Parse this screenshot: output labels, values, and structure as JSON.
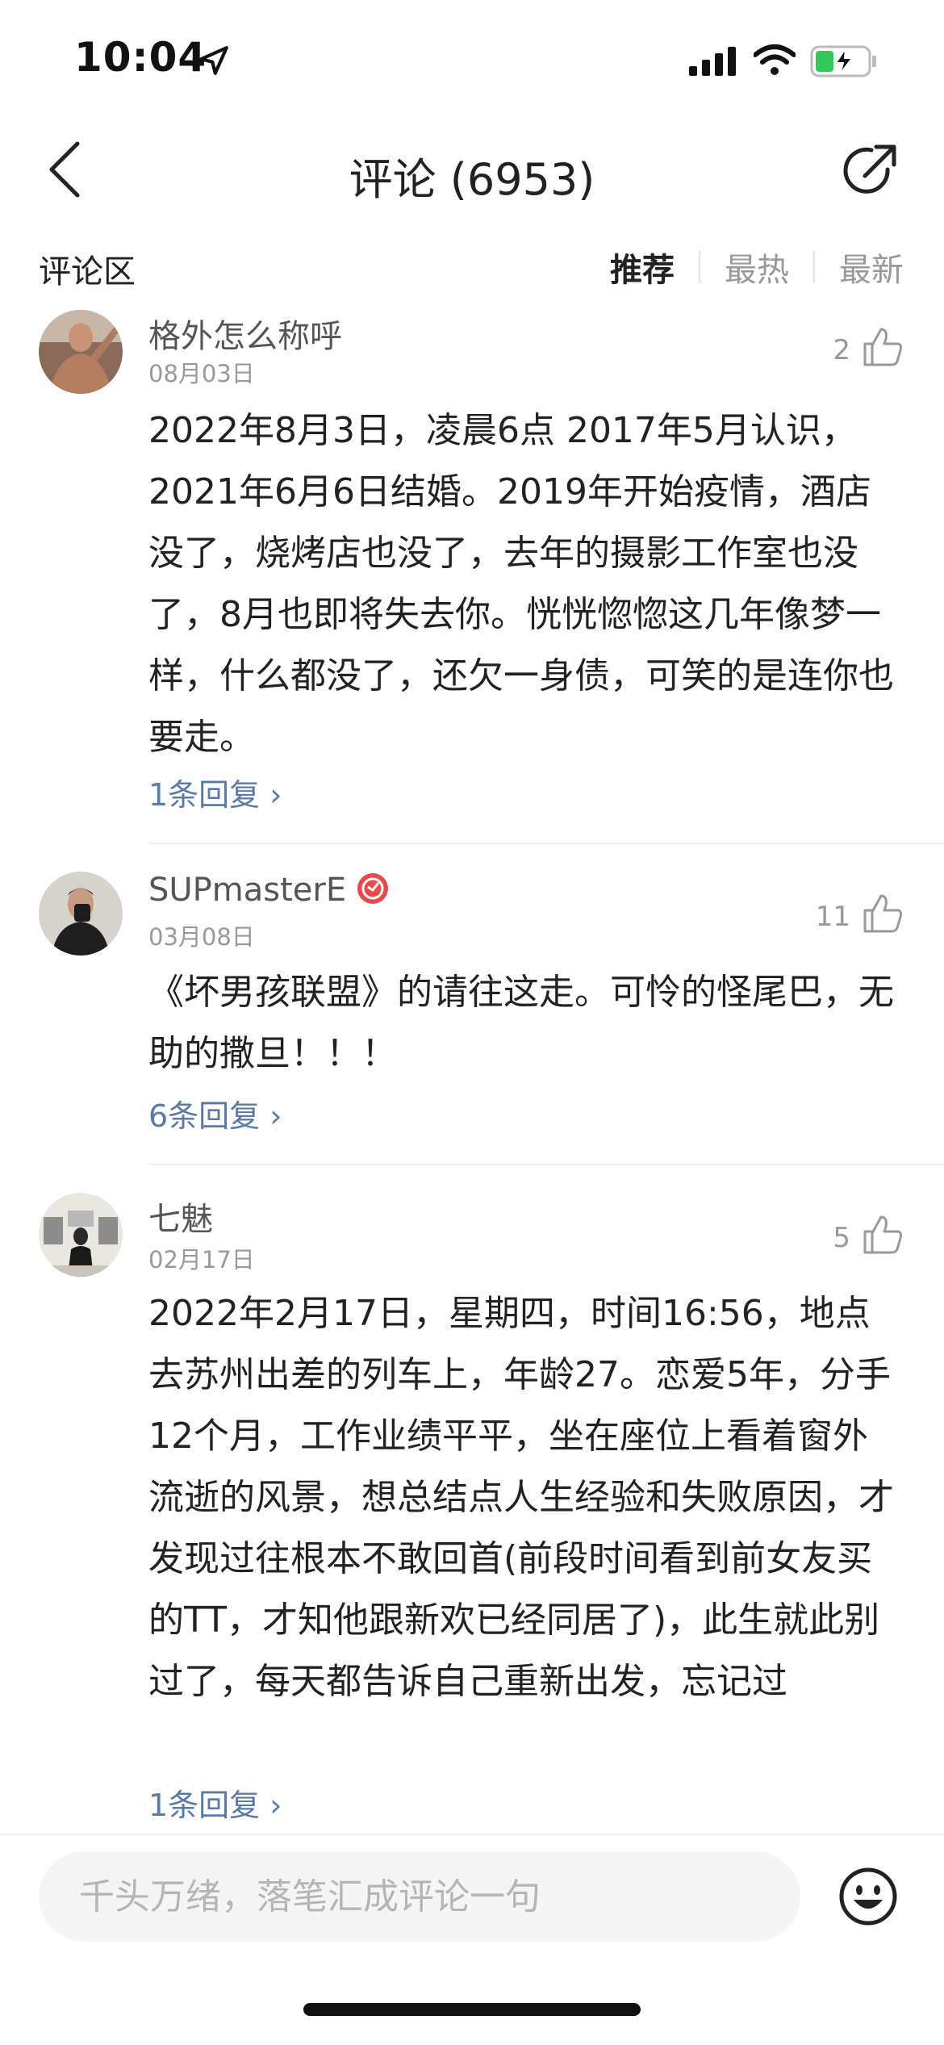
{
  "status_bar": {
    "time": "10:04"
  },
  "nav": {
    "title": "评论 (6953)"
  },
  "section": {
    "title": "评论区",
    "tabs": [
      "推荐",
      "最热",
      "最新"
    ],
    "active_tab": "推荐"
  },
  "comments": [
    {
      "username": "格外怎么称呼",
      "date": "08月03日",
      "likes": "2",
      "body": "2022年8月3日，凌晨6点 2017年5月认识，2021年6月6日结婚。2019年开始疫情，酒店没了，烧烤店也没了，去年的摄影工作室也没了，8月也即将失去你。恍恍惚惚这几年像梦一样，什么都没了，还欠一身债，可笑的是连你也要走。",
      "replies": "1条回复 ›"
    },
    {
      "username": "SUPmasterE",
      "date": "03月08日",
      "likes": "11",
      "body": "《坏男孩联盟》的请往这走。可怜的怪尾巴，无助的撒旦！！！",
      "replies": "6条回复 ›"
    },
    {
      "username": "七魅",
      "date": "02月17日",
      "likes": "5",
      "body": "2022年2月17日，星期四，时间16:56，地点去苏州出差的列车上，年龄27。恋爱5年，分手12个月，工作业绩平平，坐在座位上看着窗外流逝的风景，想总结点人生经验和失败原因，才发现过往根本不敢回首(前段时间看到前女友买的TT，才知他跟新欢已经同居了)，此生就此别过了，每天都告诉自己重新出发，忘记过",
      "replies": "1条回复 ›"
    }
  ],
  "input": {
    "placeholder": "千头万绪，落笔汇成评论一句"
  },
  "colors": {
    "link": "#5b7aa6",
    "muted": "#999999",
    "badge": "#e9494a"
  }
}
